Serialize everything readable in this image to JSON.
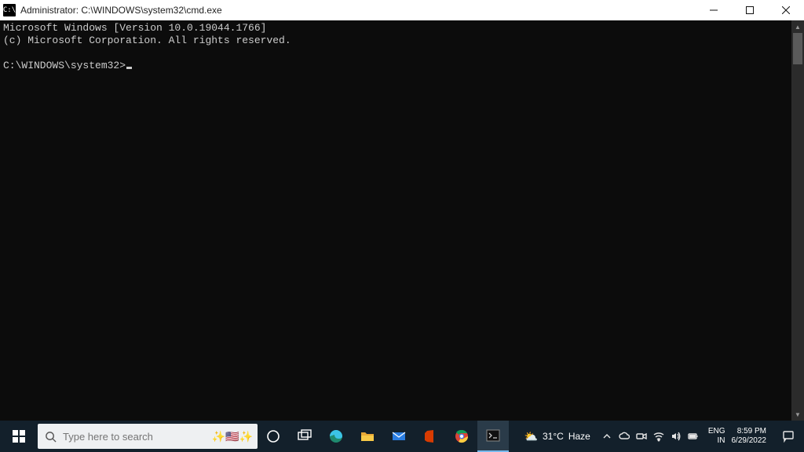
{
  "window": {
    "title": "Administrator: C:\\WINDOWS\\system32\\cmd.exe",
    "app_icon_text": "C:\\"
  },
  "terminal": {
    "line1": "Microsoft Windows [Version 10.0.19044.1766]",
    "line2": "(c) Microsoft Corporation. All rights reserved.",
    "blank": "",
    "prompt": "C:\\WINDOWS\\system32>"
  },
  "taskbar": {
    "search_placeholder": "Type here to search",
    "weather_temp": "31°C",
    "weather_desc": "Haze",
    "lang_top": "ENG",
    "lang_bottom": "IN",
    "time": "8:59 PM",
    "date": "6/29/2022"
  }
}
